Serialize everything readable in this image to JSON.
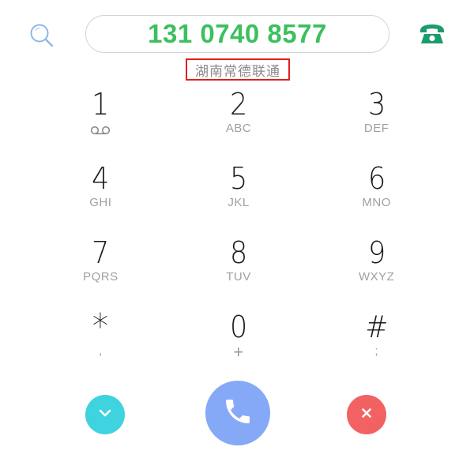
{
  "dialer": {
    "number": "131 0740 8577",
    "location": "湖南常德联通",
    "colors": {
      "number": "#3dbf5f",
      "location_highlight": "#e0201c",
      "collapse_button": "#3ed3de",
      "call_button": "#85a9f7",
      "delete_button": "#f26262"
    },
    "icons": {
      "search": "search-icon",
      "contacts": "phone-icon",
      "collapse": "chevron-down-icon",
      "call": "call-icon",
      "delete": "close-icon"
    }
  },
  "keypad": {
    "rows": [
      [
        {
          "digit": "1",
          "sub": "",
          "sub_icon": "voicemail-icon"
        },
        {
          "digit": "2",
          "sub": "ABC"
        },
        {
          "digit": "3",
          "sub": "DEF"
        }
      ],
      [
        {
          "digit": "4",
          "sub": "GHI"
        },
        {
          "digit": "5",
          "sub": "JKL"
        },
        {
          "digit": "6",
          "sub": "MNO"
        }
      ],
      [
        {
          "digit": "7",
          "sub": "PQRS"
        },
        {
          "digit": "8",
          "sub": "TUV"
        },
        {
          "digit": "9",
          "sub": "WXYZ"
        }
      ],
      [
        {
          "digit": "*",
          "sub": ","
        },
        {
          "digit": "0",
          "sub": "+"
        },
        {
          "digit": "#",
          "sub": ";"
        }
      ]
    ]
  }
}
